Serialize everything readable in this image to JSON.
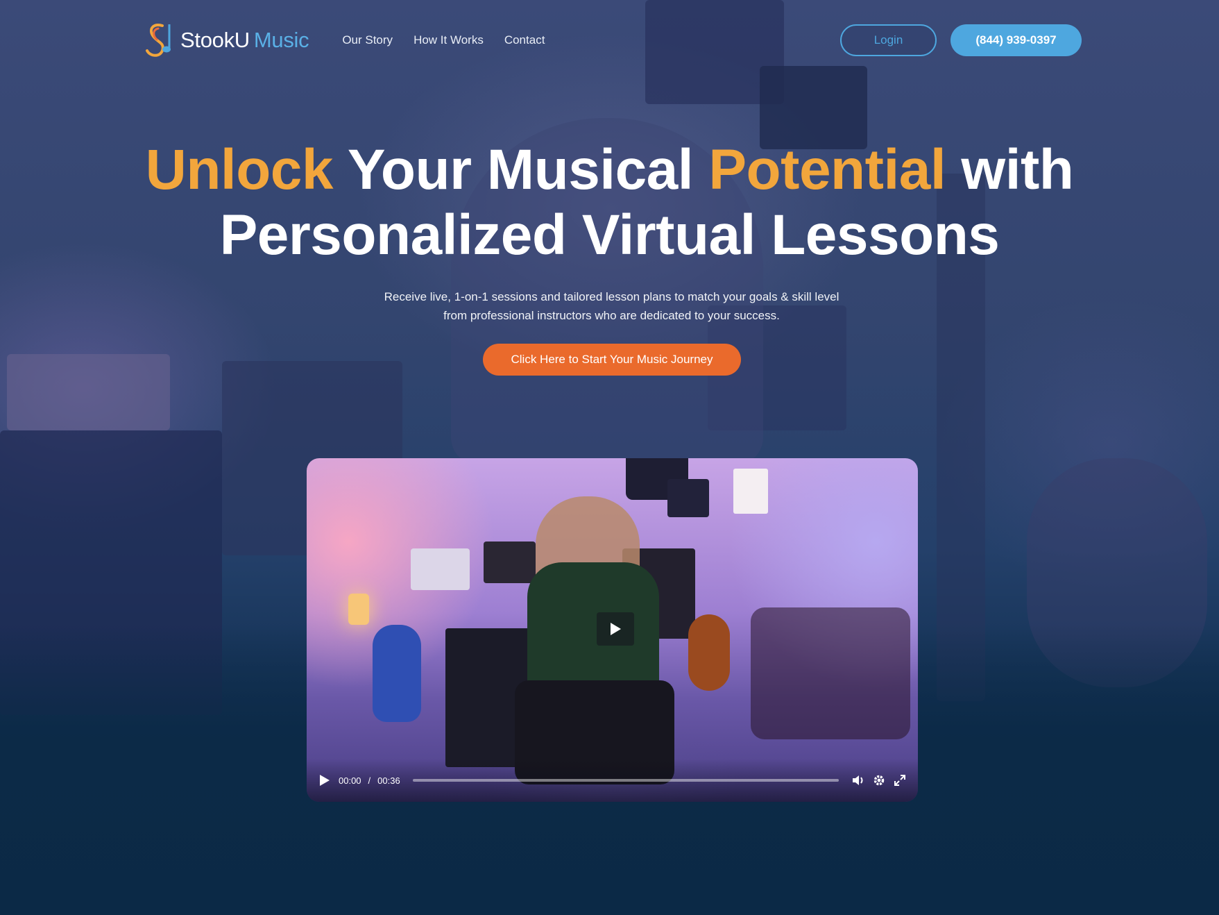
{
  "brand": {
    "name_part1": "StookU",
    "name_part2": "Music",
    "logo_icon": "stooku-s-note-logo",
    "accent_blue": "#4ea7df",
    "accent_orange": "#f2a63c",
    "cta_orange": "#ea6a2c"
  },
  "nav": {
    "items": [
      {
        "label": "Our Story"
      },
      {
        "label": "How It Works"
      },
      {
        "label": "Contact"
      }
    ],
    "login_label": "Login",
    "phone_label": "(844) 939-0397"
  },
  "hero": {
    "title_part1": "Unlock",
    "title_part2": " Your Musical ",
    "title_part3": "Potential",
    "title_part4": " with",
    "title_line2": "Personalized Virtual Lessons",
    "subtitle": "Receive live, 1-on-1 sessions and tailored lesson plans to match your goals & skill level from professional instructors who are dedicated to your success.",
    "cta_label": "Click Here to Start Your Music Journey"
  },
  "video": {
    "current_time": "00:00",
    "separator": "/",
    "duration": "00:36",
    "progress": 0,
    "icons": [
      "play-icon",
      "volume-icon",
      "settings-gear-icon",
      "fullscreen-icon"
    ]
  }
}
